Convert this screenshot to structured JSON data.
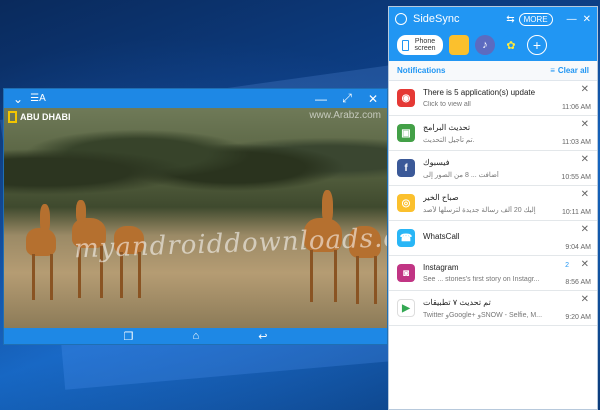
{
  "colors": {
    "accent": "#2196f3",
    "mirror_bar": "#1e88e5"
  },
  "mirror": {
    "top_icons": [
      "chevron-down-icon",
      "translate-icon"
    ],
    "right_icons": [
      "minimize-icon",
      "fullscreen-icon",
      "close-icon"
    ],
    "channel_logo": "ABU DHABI",
    "top_watermark": "www.Arabz.com",
    "watermark": "myandroiddownloads.com",
    "nav_icons": [
      "recent-apps-icon",
      "home-icon",
      "back-icon"
    ]
  },
  "sidesync": {
    "title": "SideSync",
    "more_label": "MORE",
    "phone_screen_label": "Phone screen",
    "notifications_label": "Notifications",
    "clear_all_label": "Clear all",
    "notifications": [
      {
        "app": "Google Play",
        "icon": "play-store-update-icon",
        "title": "There is 5 application(s) update",
        "text": "Click to view all",
        "time": "11:06 AM",
        "color": "#e53935"
      },
      {
        "app": "Updater",
        "icon": "android-update-icon",
        "title": "تحديث البرامج",
        "text": "تم تأجيل التحديث.",
        "time": "11:03 AM",
        "color": "#43a047"
      },
      {
        "app": "Facebook",
        "icon": "facebook-icon",
        "title": "فيسبوك",
        "text": "أضافت ... 8 من الصور إلى",
        "time": "10:55 AM",
        "color": "#3b5998"
      },
      {
        "app": "Chrome",
        "icon": "chrome-icon",
        "title": "صباح الخير",
        "text": "إليك 20 ألف رسالة جديدة لترسلها لأصد",
        "time": "10:11 AM",
        "color": "#fbc02d"
      },
      {
        "app": "WhatsCall",
        "icon": "whatscall-icon",
        "title": "WhatsCall",
        "text": "",
        "time": "9:04 AM",
        "color": "#29b6f6"
      },
      {
        "app": "Instagram",
        "icon": "instagram-icon",
        "title": "Instagram",
        "text": "See ... stories's first story on Instagr...",
        "time": "8:56 AM",
        "count": "2",
        "color": "#c13584"
      },
      {
        "app": "Play Store",
        "icon": "play-store-icon",
        "title": "تم تحديث ٧ تطبيقات",
        "text": "Twitter وGoogle+ وSNOW - Selfie, M...",
        "time": "9:20 AM",
        "color": "#ffffff"
      }
    ]
  }
}
